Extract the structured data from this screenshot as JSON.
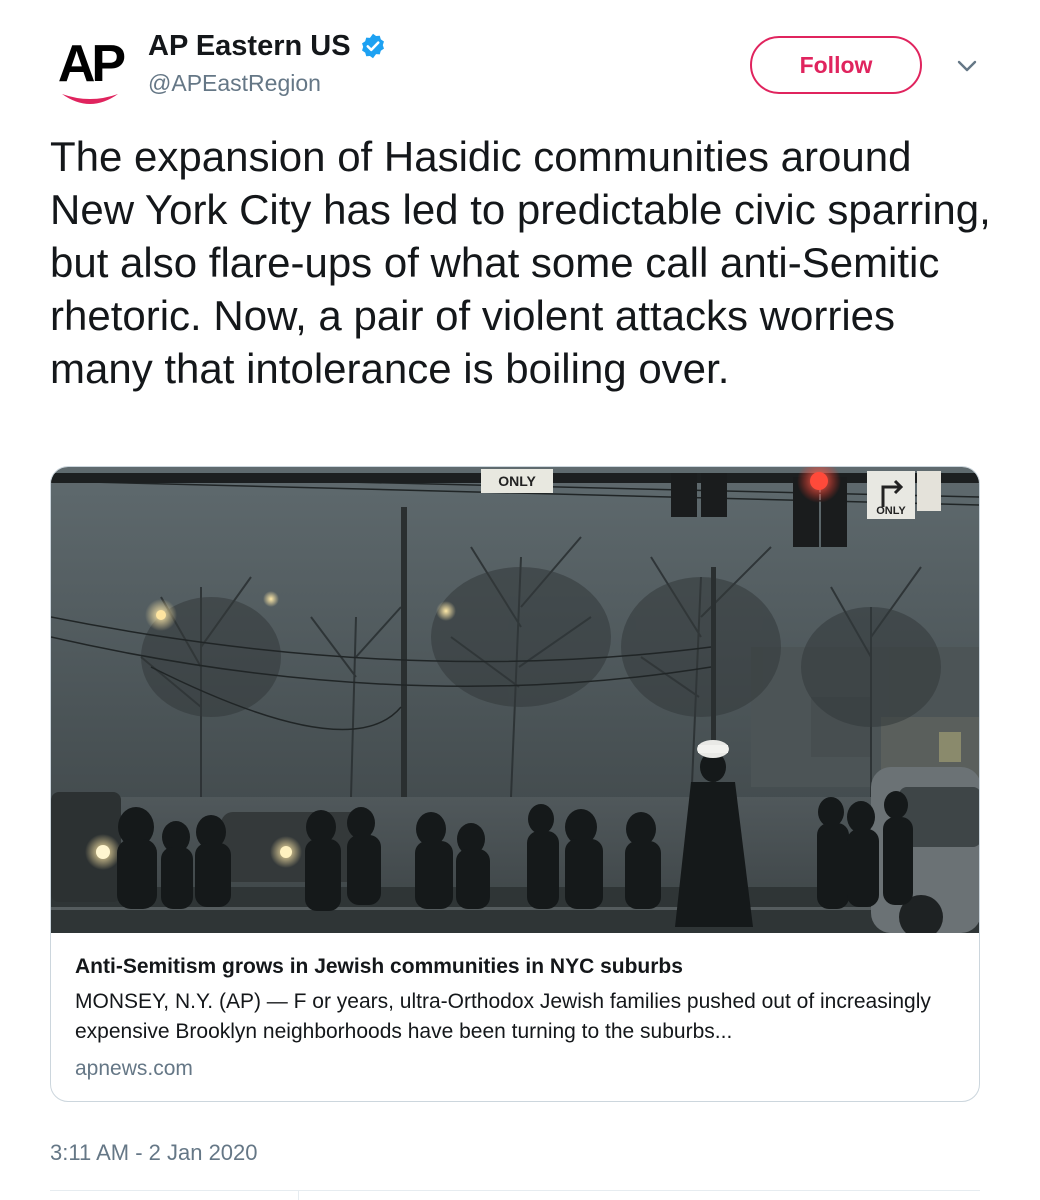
{
  "account": {
    "name": "AP Eastern US",
    "handle": "@APEastRegion",
    "avatar_text": "AP",
    "verified": true
  },
  "actions": {
    "follow_label": "Follow"
  },
  "tweet": {
    "text": "The expansion of Hasidic communities around New York City has led to predictable civic sparring, but also flare-ups of what some call anti-Semitic rhetoric. Now, a pair of violent attacks worries many that intolerance is boiling over.",
    "timestamp": "3:11 AM - 2 Jan 2020"
  },
  "card": {
    "title": "Anti-Semitism grows in Jewish communities in NYC suburbs",
    "description": "MONSEY, N.Y. (AP) — F or years, ultra-Orthodox Jewish families pushed out of increasingly expensive Brooklyn neighborhoods have been turning to the suburbs...",
    "domain": "apnews.com",
    "image_signs": {
      "left_sign": "ONLY",
      "right_sign": "ONLY"
    }
  },
  "colors": {
    "brand_red": "#e0245e",
    "verified_blue": "#1da1f2",
    "muted_text": "#657786",
    "border": "#ccd6dd"
  },
  "icons": {
    "verified": "verified-badge-icon",
    "caret": "chevron-down-icon"
  }
}
